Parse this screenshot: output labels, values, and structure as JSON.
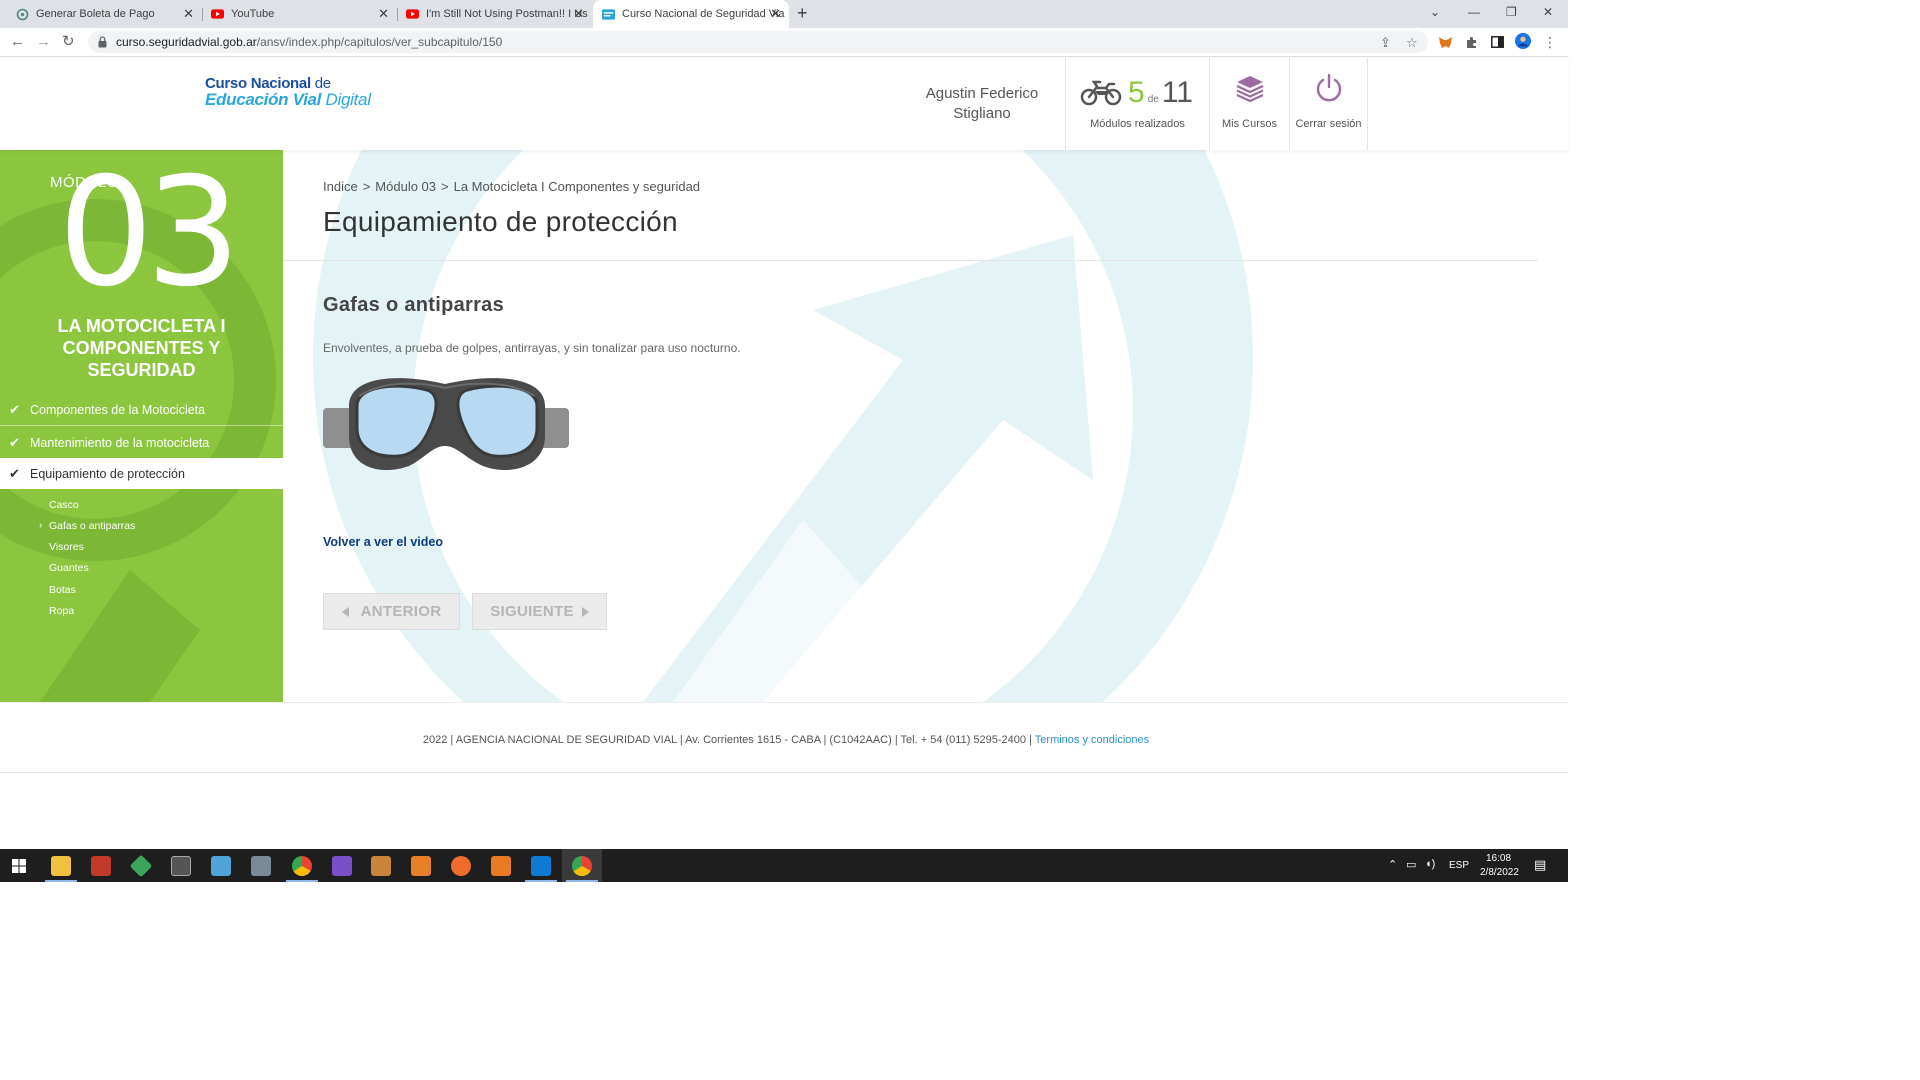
{
  "browser": {
    "tabs": [
      {
        "title": "Generar Boleta de Pago",
        "icon": "agency-icon",
        "active": false
      },
      {
        "title": "YouTube",
        "icon": "youtube-icon",
        "active": false
      },
      {
        "title": "I'm Still Not Using Postman!! I Us",
        "icon": "youtube-icon",
        "active": false
      },
      {
        "title": "Curso Nacional de Seguridad Via",
        "icon": "site-icon",
        "active": true
      }
    ],
    "url_host": "curso.seguridadvial.gob.ar",
    "url_path": "/ansv/index.php/capitulos/ver_subcapitulo/150"
  },
  "header": {
    "logo_line1_bold": "Curso Nacional",
    "logo_line1_rest": " de",
    "logo_line2_bold": "Educación Vial",
    "logo_line2_rest": " Digital",
    "user_name": "Agustin Federico Stigliano",
    "progress_done": "5",
    "progress_of": "de",
    "progress_total": "11",
    "progress_caption": "Módulos realizados",
    "courses_label": "Mis Cursos",
    "logout_label": "Cerrar sesión"
  },
  "sidebar": {
    "module_label": "MÓDULO",
    "module_number": "03",
    "module_title": "LA MOTOCICLETA I COMPONENTES Y SEGURIDAD",
    "chapters": [
      {
        "label": "Componentes de la Motocicleta",
        "done": true
      },
      {
        "label": "Mantenimiento de la motocicleta",
        "done": true
      },
      {
        "label": "Equipamiento de protección",
        "done": true,
        "active": true
      }
    ],
    "subchapters": [
      "Casco",
      "Gafas o antiparras",
      "Visores",
      "Guantes",
      "Botas",
      "Ropa"
    ],
    "current_subchapter": "Gafas o antiparras"
  },
  "content": {
    "breadcrumb": [
      "Indice",
      "Módulo 03",
      "La Motocicleta I Componentes y seguridad"
    ],
    "page_title": "Equipamiento de protección",
    "section_title": "Gafas o antiparras",
    "description": "Envolventes, a prueba de golpes, antirrayas, y sin tonalizar para uso nocturno.",
    "video_link": "Volver a ver el video",
    "prev_label": "ANTERIOR",
    "next_label": "SIGUIENTE"
  },
  "footer": {
    "text": "2022 | AGENCIA NACIONAL DE SEGURIDAD VIAL | Av. Corrientes 1615 - CABA | (C1042AAC) | Tel. + 54 (011) 5295-2400 | ",
    "link": "Terminos y condiciones"
  },
  "taskbar": {
    "lang": "ESP",
    "time": "16:08",
    "date": "2/8/2022"
  },
  "colors": {
    "sidebar_green": "#8cc63f",
    "brand_blue": "#1b4fa0",
    "link_blue": "#0d3b80",
    "arrow_watermark": "#e3f3f6"
  }
}
